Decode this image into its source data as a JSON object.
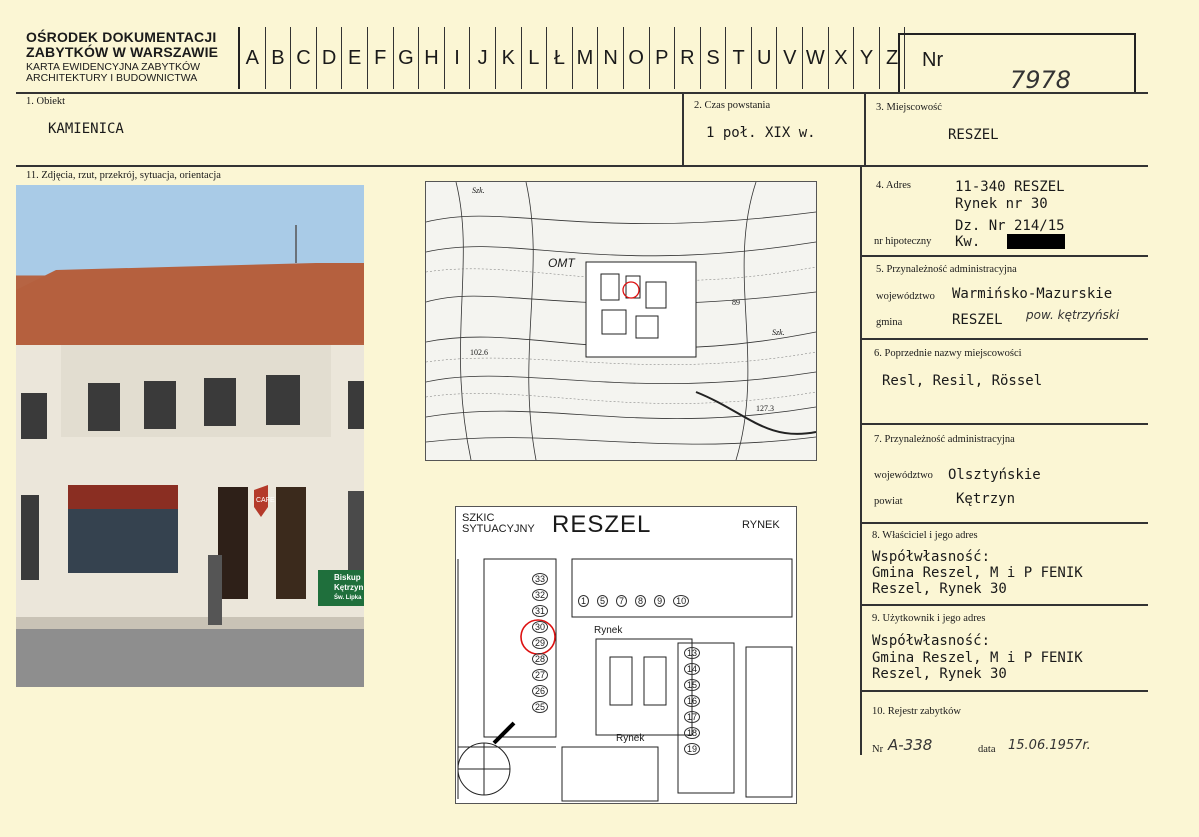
{
  "header": {
    "org_line1": "OŚRODEK DOKUMENTACJI",
    "org_line2": "ZABYTKÓW W WARSZAWIE",
    "sub_line1": "KARTA EWIDENCYJNA ZABYTKÓW",
    "sub_line2": "ARCHITEKTURY I BUDOWNICTWA",
    "letters": [
      "A",
      "B",
      "C",
      "D",
      "E",
      "F",
      "G",
      "H",
      "I",
      "J",
      "K",
      "L",
      "Ł",
      "M",
      "N",
      "O",
      "P",
      "R",
      "S",
      "T",
      "U",
      "V",
      "W",
      "X",
      "Y",
      "Z"
    ],
    "nr_label": "Nr",
    "nr_value": "7978"
  },
  "obiekt": {
    "label": "1. Obiekt",
    "value": "KAMIENICA"
  },
  "czas": {
    "label": "2. Czas powstania",
    "value": "1 poł. XIX w."
  },
  "miejscowosc": {
    "label": "3. Miejscowość",
    "value": "RESZEL"
  },
  "zdjecia": {
    "label": "11. Zdjęcia, rzut, przekrój, sytuacja, orientacja"
  },
  "photo": {
    "sign_cafe": "CAFE",
    "sign_line1": "Biskup",
    "sign_line2": "Kętrzyn",
    "sign_line3": "Św. Lipka"
  },
  "map1": {
    "labels": [
      "OMT",
      "102.6",
      "127.3",
      "89",
      "Szk.",
      "Szk."
    ]
  },
  "map2": {
    "title_line1": "SZKIC",
    "title_line2": "SYTUACYJNY",
    "town": "RESZEL",
    "corner": "RYNEK",
    "street1": "Rynek",
    "street2": "Rynek",
    "numbers_top": [
      "1",
      "5",
      "7",
      "8",
      "9",
      "10"
    ],
    "numbers_left": [
      "33",
      "32",
      "31",
      "30",
      "29",
      "28",
      "27",
      "26",
      "25"
    ],
    "numbers_right_a": [
      "13",
      "14",
      "15",
      "16",
      "17",
      "18",
      "19"
    ]
  },
  "adres": {
    "label": "4. Adres",
    "line1": "11-340 RESZEL",
    "line2": "Rynek nr 30",
    "dz": "Dz.  Nr  214/15",
    "hip_label": "nr hipoteczny",
    "kw": "Kw."
  },
  "przyn5": {
    "label": "5. Przynależność administracyjna",
    "woj_label": "województwo",
    "woj_value": "Warmińsko-Mazurskie",
    "gmina_label": "gmina",
    "gmina_value": "RESZEL",
    "gmina_note": "pow. kętrzyński"
  },
  "poprz": {
    "label": "6. Poprzednie nazwy miejscowości",
    "value": "Resl, Resil, Rössel"
  },
  "przyn7": {
    "label": "7. Przynależność administracyjna",
    "woj_label": "województwo",
    "woj_value": "Olsztyńskie",
    "powiat_label": "powiat",
    "powiat_value": "Kętrzyn"
  },
  "wlasciciel": {
    "label": "8. Właściciel i jego adres",
    "line1": "Współwłasność:",
    "line2": "Gmina Reszel, M i P FENIK",
    "line3": "Reszel, Rynek 30"
  },
  "uzytkownik": {
    "label": "9. Użytkownik i jego adres",
    "line1": "Współwłasność:",
    "line2": "Gmina Reszel, M i P FENIK",
    "line3": "Reszel, Rynek 30"
  },
  "rejestr": {
    "label": "10. Rejestr zabytków",
    "nr_label": "Nr",
    "nr_value": "A-338",
    "data_label": "data",
    "data_value": "15.06.1957r."
  }
}
